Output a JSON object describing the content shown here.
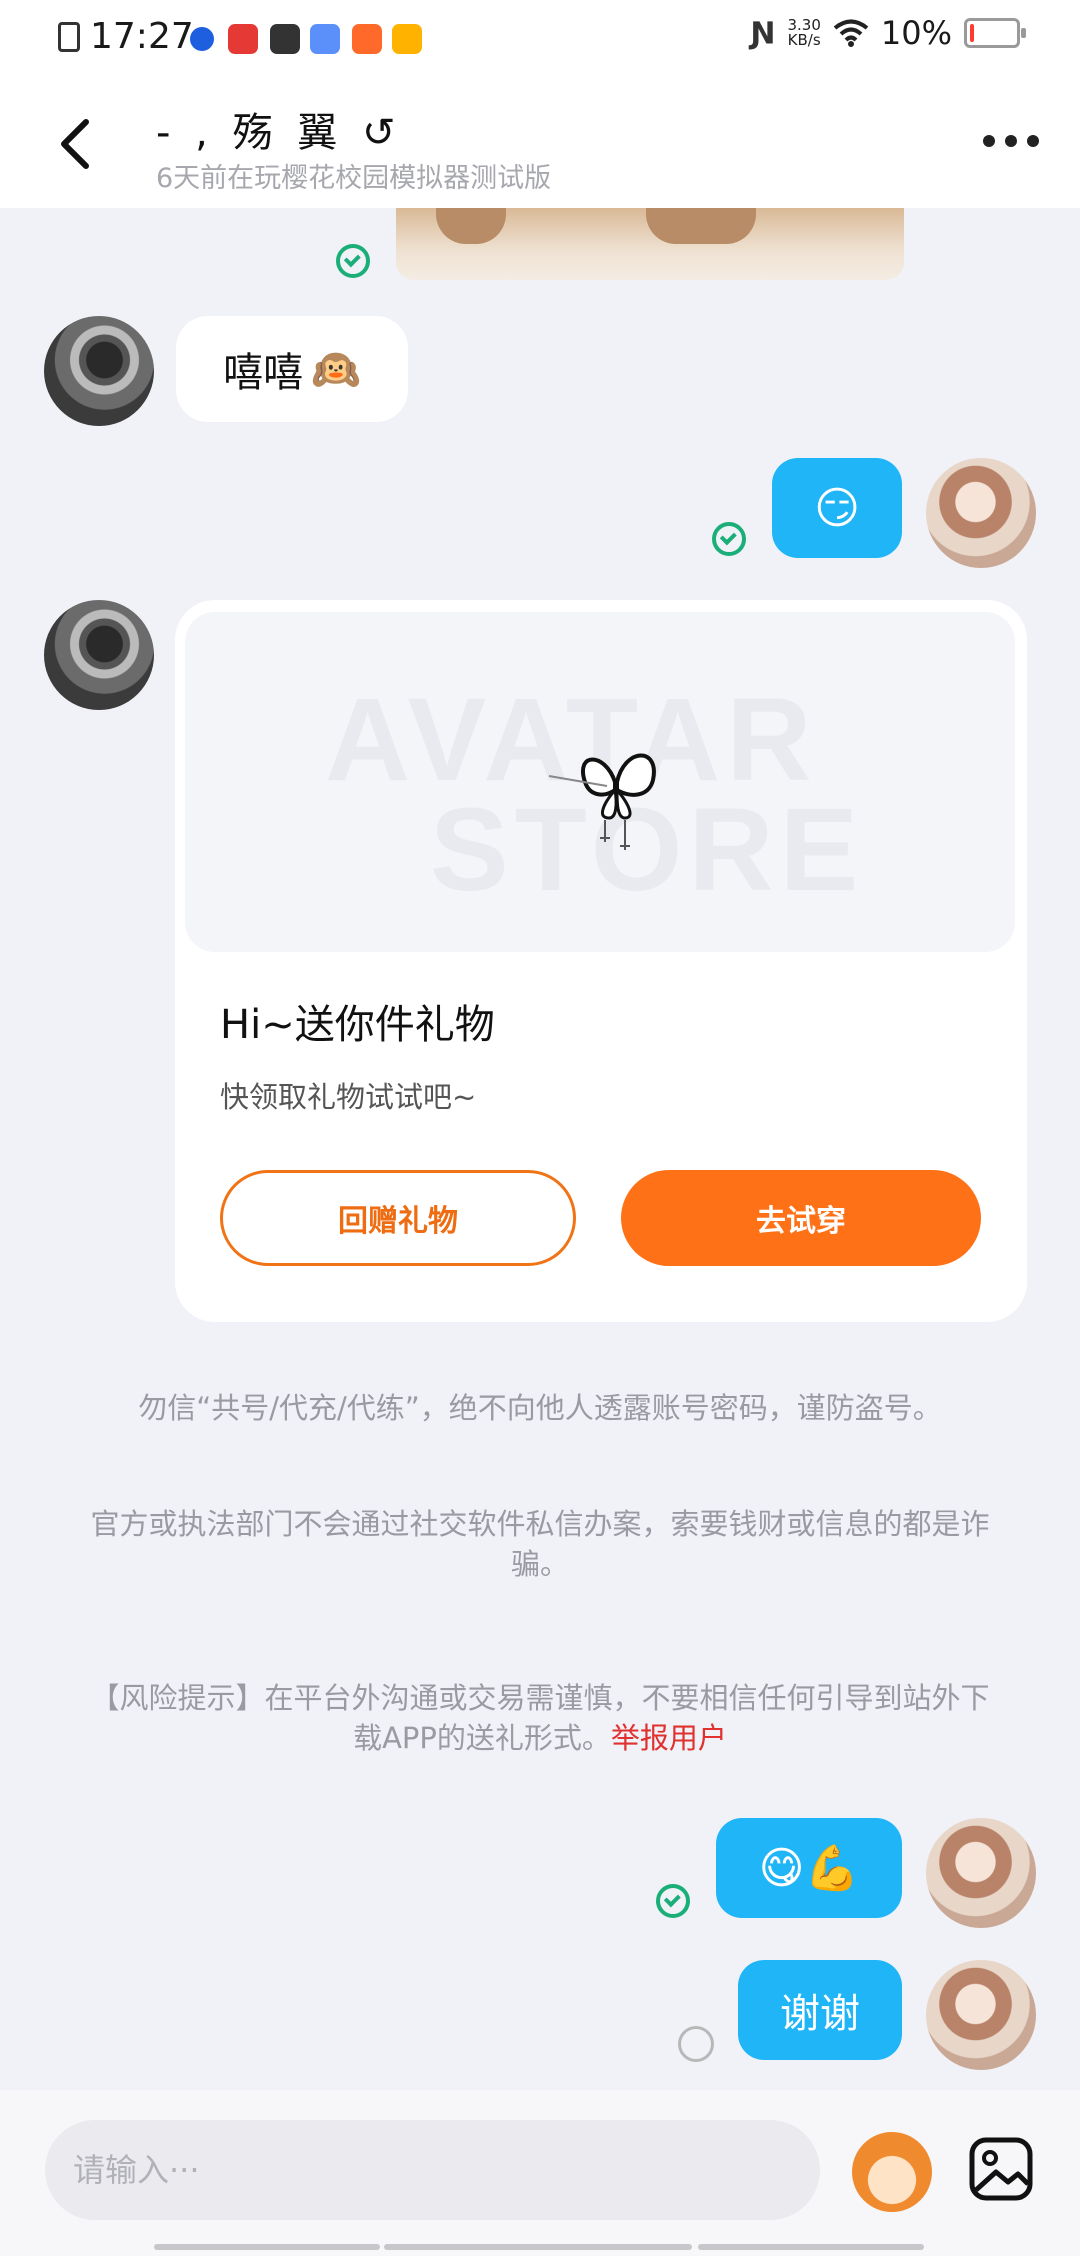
{
  "status_bar": {
    "time": "17:27",
    "net_speed_value": "3.30",
    "net_speed_unit": "KB/s",
    "battery_percent": "10%",
    "battery_level": 0.1
  },
  "header": {
    "title": "- , 殇 翼 ↺",
    "subtitle": "6天前在玩樱花校园模拟器测试版"
  },
  "messages": [
    {
      "from": "other",
      "text": "嘻嘻",
      "emoji": "🙉"
    },
    {
      "from": "self",
      "emoji": "😏",
      "status": "read"
    },
    {
      "from": "other",
      "type": "gift",
      "watermark_top": "AVATAR",
      "watermark_bottom": "STORE",
      "title": "Hi~送你件礼物",
      "subtitle": "快领取礼物试试吧~",
      "return_label": "回赠礼物",
      "try_label": "去试穿"
    },
    {
      "from": "self",
      "emoji": "😋💪",
      "status": "read"
    },
    {
      "from": "self",
      "text": "谢谢",
      "status": "pending"
    }
  ],
  "notices": {
    "warning1": "勿信“共号/代充/代练”，绝不向他人透露账号密码，谨防盗号。",
    "warning2": "官方或执法部门不会通过社交软件私信办案，索要钱财或信息的都是诈骗。",
    "risk_prefix": "【风险提示】在平台外沟通或交易需谨慎，不要相信任何引导到站外下载APP的送礼形式。",
    "report_link": "举报用户"
  },
  "input_bar": {
    "placeholder": "请输入···"
  },
  "icons": {
    "back": "chevron-left-icon",
    "more": "more-dots-icon",
    "sticker": "monkey-sticker-icon",
    "image": "image-icon"
  },
  "colors": {
    "bubble_self": "#1fb5f7",
    "accent_orange": "#ff7116",
    "read_check": "#1cae79",
    "report_red": "#e0312f"
  }
}
